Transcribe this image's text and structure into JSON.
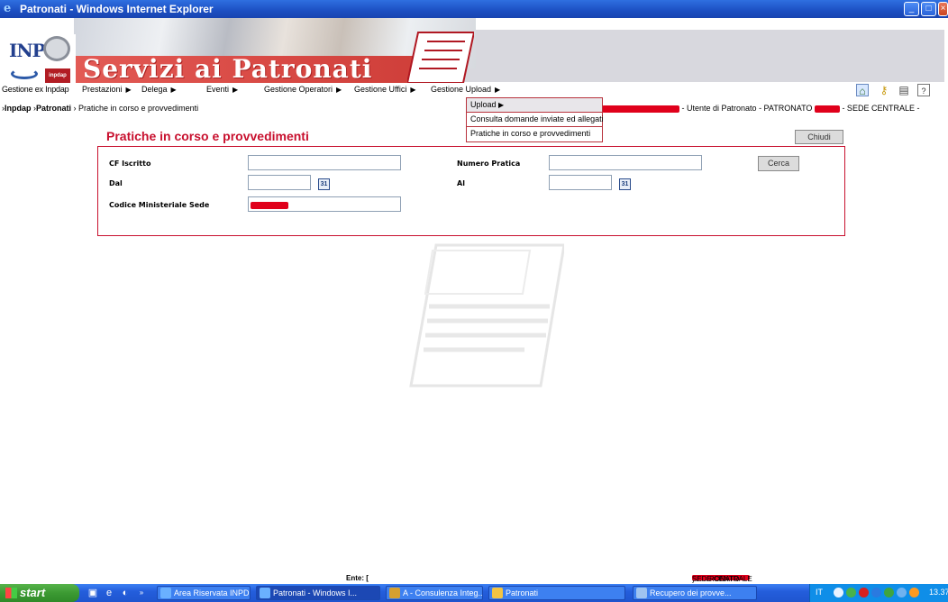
{
  "window": {
    "title": "Patronati - Windows Internet Explorer"
  },
  "header": {
    "brand": "Servizi ai Patronati",
    "logo_text": "INPS",
    "logo_sub": "inpdap"
  },
  "menu": {
    "first": "Gestione ex Inpdap",
    "items": [
      "Prestazioni",
      "Delega",
      "Eventi",
      "Gestione Operatori",
      "Gestione Uffici",
      "Gestione Upload"
    ]
  },
  "dropdown": {
    "items": [
      "Upload",
      "Consulta domande inviate ed allegati",
      "Pratiche in corso e provvedimenti"
    ]
  },
  "breadcrumb": {
    "root": "Inpdap",
    "section": "Patronati",
    "page": "Pratiche in corso e provvedimenti"
  },
  "userinfo": {
    "text_a": "- Utente di Patronato - PATRONATO",
    "text_b": "- SEDE CENTRALE -"
  },
  "page": {
    "title": "Pratiche in corso e provvedimenti",
    "close_label": "Chiudi"
  },
  "form": {
    "cf_label": "CF Iscritto",
    "numero_label": "Numero Pratica",
    "dal_label": "Dal",
    "al_label": "Al",
    "codice_label": "Codice Ministeriale Sede",
    "search_label": "Cerca",
    "cf_value": "",
    "numero_value": "",
    "dal_value": "",
    "al_value": "",
    "calendar_icon_text": "31"
  },
  "status": {
    "ente_prefix": "Ente: [",
    "ente_mid": "] PATRONATO",
    "ente_suffix": " SEDE CENTRALE"
  },
  "taskbar": {
    "start": "start",
    "tasks": [
      "Area Riservata INPD...",
      "Patronati - Windows I...",
      "A - Consulenza Integ...",
      "Patronati",
      "Recupero dei provve..."
    ],
    "lang": "IT",
    "clock": "13.37"
  }
}
